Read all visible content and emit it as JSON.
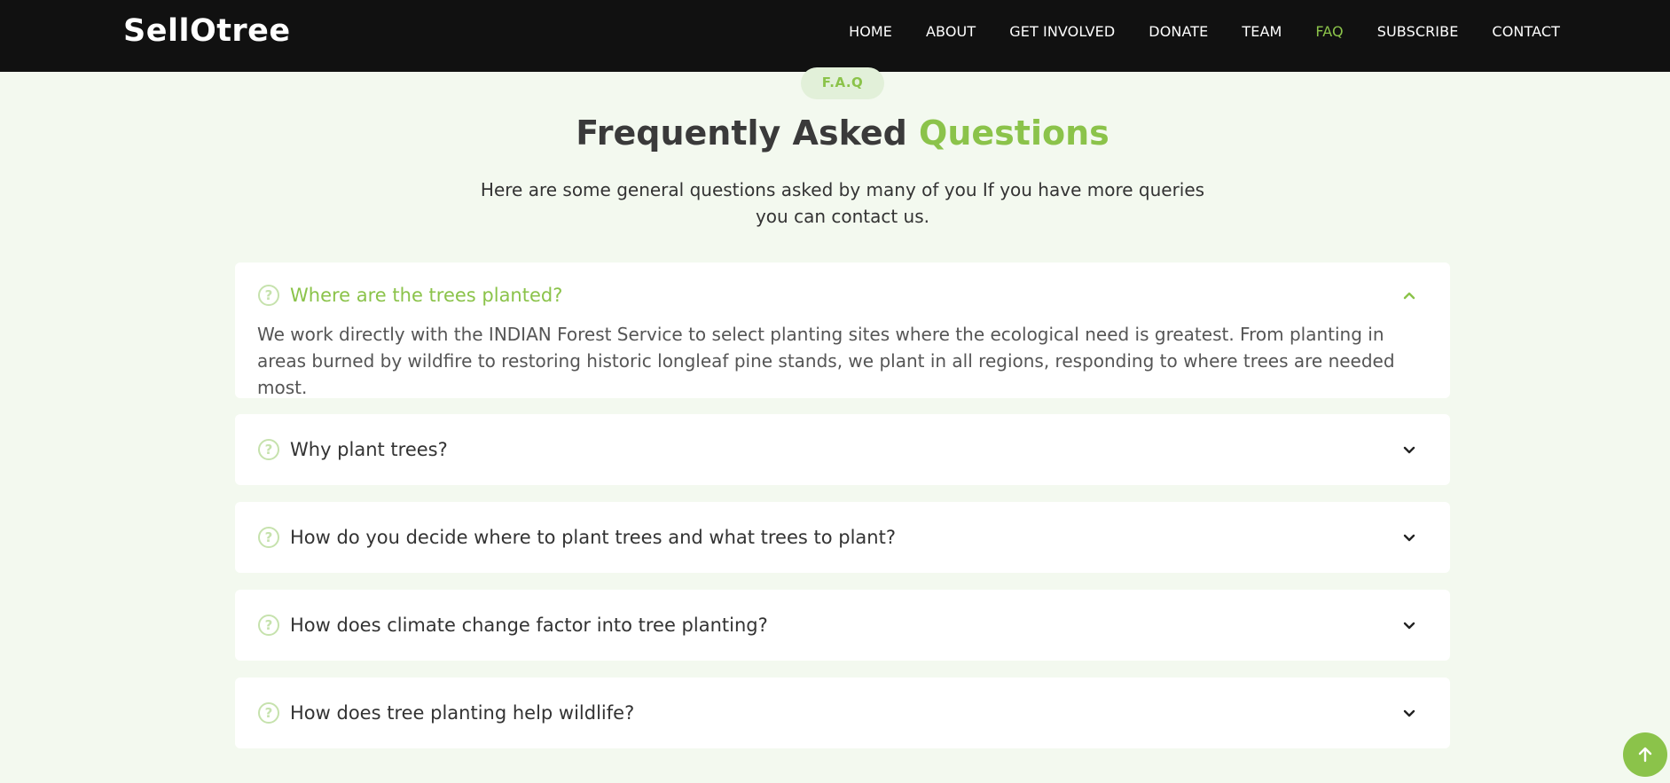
{
  "brand": "SellOtree",
  "nav": {
    "items": [
      "HOME",
      "ABOUT",
      "GET INVOLVED",
      "DONATE",
      "TEAM",
      "FAQ",
      "SUBSCRIBE",
      "CONTACT"
    ],
    "active": "FAQ"
  },
  "section": {
    "badge": "F.A.Q",
    "title_main": "Frequently Asked ",
    "title_accent": "Questions",
    "subtitle": "Here are some general questions asked by many of you If you have more queries you can contact us."
  },
  "faq": [
    {
      "question": "Where are the trees planted?",
      "answer": "We work directly with the INDIAN Forest Service to select planting sites where the ecological need is greatest. From planting in areas burned by wildfire to restoring historic longleaf pine stands, we plant in all regions, responding to where trees are needed most.",
      "expanded": true
    },
    {
      "question": "Why plant trees?",
      "expanded": false
    },
    {
      "question": "How do you decide where to plant trees and what trees to plant?",
      "expanded": false
    },
    {
      "question": "How does climate change factor into tree planting?",
      "expanded": false
    },
    {
      "question": "How does tree planting help wildlife?",
      "expanded": false
    }
  ],
  "icons": {
    "question": "question-circle-icon",
    "chevron_up": "chevron-up-icon",
    "chevron_down": "chevron-down-icon",
    "back_to_top": "arrow-up-icon"
  },
  "colors": {
    "accent": "#8bc34a",
    "navbar": "#111111",
    "background": "#f3f9ef"
  }
}
